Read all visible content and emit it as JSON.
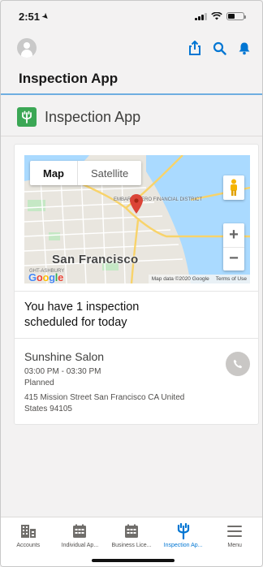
{
  "status_bar": {
    "time": "2:51"
  },
  "app": {
    "title": "Inspection App"
  },
  "page_header": {
    "title": "Inspection App"
  },
  "map": {
    "tabs": [
      "Map",
      "Satellite"
    ],
    "active_tab": "Map",
    "city_label": "San Francisco",
    "district_label": "EMBARCADERO FINANCIAL DISTRICT",
    "neighborhood_label": "GHT-ASHBURY",
    "attribution": "Map data ©2020 Google",
    "terms": "Terms of Use",
    "zoom_in": "+",
    "zoom_out": "−"
  },
  "summary": "You have 1 inspection scheduled for today",
  "inspection": {
    "name": "Sunshine Salon",
    "time": "03:00 PM - 03:30 PM",
    "status": "Planned",
    "address": "415 Mission Street San Francisco CA United States 94105"
  },
  "tabs": [
    {
      "label": "Accounts",
      "icon": "accounts-icon"
    },
    {
      "label": "Individual Ap...",
      "icon": "individual-app-icon"
    },
    {
      "label": "Business Lice...",
      "icon": "business-license-icon"
    },
    {
      "label": "Inspection Ap...",
      "icon": "inspection-app-icon",
      "active": true
    },
    {
      "label": "Menu",
      "icon": "menu-icon"
    }
  ],
  "colors": {
    "brand_blue": "#0176d3",
    "app_icon_green": "#3ba755",
    "pin_red": "#db4437"
  }
}
